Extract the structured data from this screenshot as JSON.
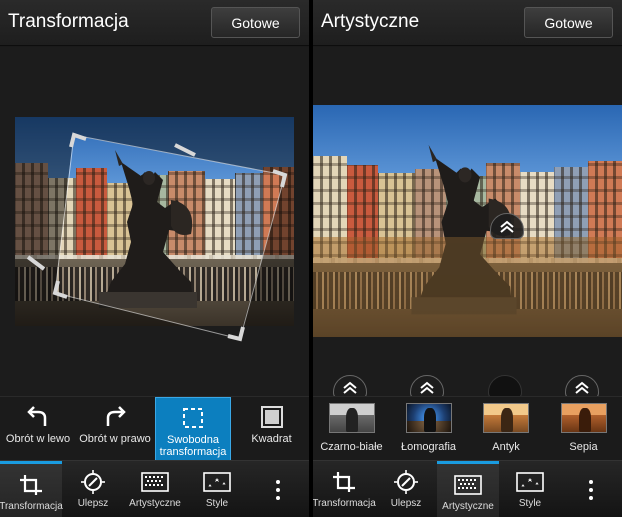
{
  "left": {
    "title": "Transformacja",
    "done_label": "Gotowe",
    "tools": [
      {
        "label": "Obrót w lewo",
        "icon": "rotate-left-icon"
      },
      {
        "label": "Obrót w prawo",
        "icon": "rotate-right-icon"
      },
      {
        "label": "Swobodna transformacja",
        "icon": "free-transform-icon",
        "active": true
      },
      {
        "label": "Kwadrat",
        "icon": "square-crop-icon"
      }
    ]
  },
  "right": {
    "title": "Artystyczne",
    "done_label": "Gotowe",
    "filters": [
      {
        "label": "Czarno-białe",
        "icon": "black-white-thumb"
      },
      {
        "label": "Łomografia",
        "icon": "lomography-thumb"
      },
      {
        "label": "Antyk",
        "icon": "antique-thumb"
      },
      {
        "label": "Sepia",
        "icon": "sepia-thumb"
      }
    ]
  },
  "nav": {
    "items": [
      {
        "label": "Transformacja",
        "icon": "transform-icon"
      },
      {
        "label": "Ulepsz",
        "icon": "enhance-icon"
      },
      {
        "label": "Artystyczne",
        "icon": "artistic-icon"
      },
      {
        "label": "Style",
        "icon": "style-icon"
      }
    ],
    "left_active": 0,
    "right_active": 2
  },
  "colors": {
    "accent": "#0c7fbf",
    "nav_indicator": "#1a9ce0",
    "background": "#1a1a1a"
  }
}
